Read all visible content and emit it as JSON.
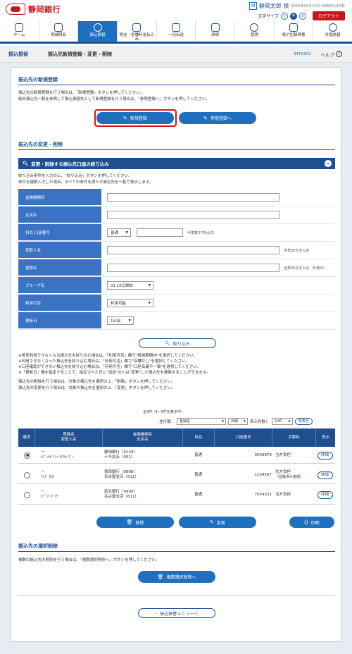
{
  "header": {
    "bank_name": "静岡銀行",
    "user_icon": "ｲｵ",
    "user_name": "静岡太郎 様",
    "last_login": "20XX年02月13日 10時00分00秒",
    "font_size_label": "文字サイズ",
    "font_small": "小",
    "font_medium": "中",
    "font_large": "大",
    "logout_label": "ログアウト"
  },
  "nav": [
    {
      "label": "ホーム",
      "icon": "home-icon"
    },
    {
      "label": "明細照会",
      "icon": "document-icon"
    },
    {
      "label": "振込振替",
      "icon": "yen-icon"
    },
    {
      "label": "税金・各種料金払込み",
      "icon": "card-icon"
    },
    {
      "label": "一括伝送",
      "icon": "transfer-icon"
    },
    {
      "label": "承認",
      "icon": "stamp-icon"
    },
    {
      "label": "管理",
      "icon": "person-icon"
    },
    {
      "label": "電子記録債権",
      "icon": "ledger-icon"
    },
    {
      "label": "外国為替",
      "icon": "globe-icon"
    }
  ],
  "titlebar": {
    "crumb": "振込振替",
    "title": "振込先新規登録・変更・削除",
    "screen_id": "BFFK002",
    "help": "ヘルプ"
  },
  "new_reg": {
    "title": "振込先の新規登録",
    "line1": "振込先の新規登録を行う場合は、「新規登録」ボタンを押してください。",
    "line2": "総合振込先一覧を参照して振込振替先として新規登録を行う場合は、「参照登録へ」ボタンを押してください。",
    "new_btn": "新規登録",
    "ref_btn": "参照登録へ"
  },
  "change_delete": {
    "title": "振込先の変更・削除",
    "filter_title": "変更・削除する振込先口座の絞り込み",
    "filter_line1": "絞り込み条件を入力の上、「絞り込み」ボタンを押してください。",
    "filter_line2": "条件を複数入力した場合、すべての条件を満たす振込先を一覧で表示します。",
    "fields": {
      "bank": "金融機関名",
      "branch": "支店名",
      "account": "科目 口座番号",
      "account_type": "普通",
      "account_note": "半角数字7桁以内",
      "payee": "受取人名",
      "payee_note": "半角30文字以内",
      "reg_name": "登録名",
      "reg_note": "全角30文字以内［半角可］",
      "group": "グループ名",
      "group_value": "01 10日締め",
      "usable": "利用可否",
      "usable_value": "利用可能",
      "updated": "更新日",
      "updated_value": "1日前"
    },
    "filter_btn": "絞り込み",
    "notes": [
      "※将来利用できなくなる振込先を絞り込む場合は、「利用可否」欄で\"経過期間中\"を選択してください。",
      "※利用できなくなった振込先を絞り込む場合は、「利用可否」欄で\"店舗なし\"を選択してください。",
      "※口座確認ができない振込先を絞り込む場合は、「利用可否」欄で\"口座名義不一致\"を選択してください。",
      "※「更新日」欄を指定することで、指定された日に\"追加\"または\"変更\"した振込先を検索することができます。"
    ],
    "delete_note": "振込先の削除を行う場合は、対象の振込先を選択の上、「削除」ボタンを押してください。",
    "change_note": "振込先の変更を行う場合は、対象の振込先を選択の上、「変更」ボタンを押してください。",
    "count": "全3件（1~3件を表示中）",
    "sort_label": "並び順：",
    "sort_value": "登録名",
    "order_value": "昇順",
    "per_page_label": "表示件数：",
    "per_page_value": "10件",
    "resort_btn": "再表示"
  },
  "table": {
    "headers": [
      "選択",
      "登録名\n受取人名",
      "金融機関名\n支店名",
      "科目",
      "口座番号",
      "手数料",
      "表示"
    ],
    "rows": [
      {
        "reg": "ー",
        "payee": "ｶﾌﾞｼｷｶﾞｲｼｬ ｻｸﾗｶﾞｸﾞﾝ",
        "bank": "静岡銀行（0149）",
        "branch": "デモ支店（952）",
        "type": "普通",
        "acct": "0009876",
        "fee": "当方負担",
        "fee2": "",
        "detail": "詳細",
        "selected": true
      },
      {
        "reg": "ー",
        "payee": "ｱｲｽﾞ ﾀﾛｳ",
        "bank": "東西銀行（8888）",
        "branch": "名古屋支店（611）",
        "type": "普通",
        "acct": "1234567",
        "fee": "先方負担",
        "fee2": "（登録済み金額）",
        "detail": "詳細",
        "selected": false
      },
      {
        "reg": "ー",
        "payee": "ﾀﾌﾞﾗｲ ﾀﾞｲﾁ",
        "bank": "南北銀行（9999）",
        "branch": "名古屋支店（611）",
        "type": "普通",
        "acct": "7654321",
        "fee": "当方負担",
        "fee2": "",
        "detail": "詳細",
        "selected": false
      }
    ]
  },
  "actions": {
    "delete": "削除",
    "change": "変更",
    "print": "印刷"
  },
  "bulk_delete": {
    "title": "振込先の選択削除",
    "line": "複数の振込先の削除を行う場合は、「複数選択削除へ」ボタンを押してください。",
    "btn": "複数選択削除へ"
  },
  "back_btn": "振込振替メニューへ"
}
